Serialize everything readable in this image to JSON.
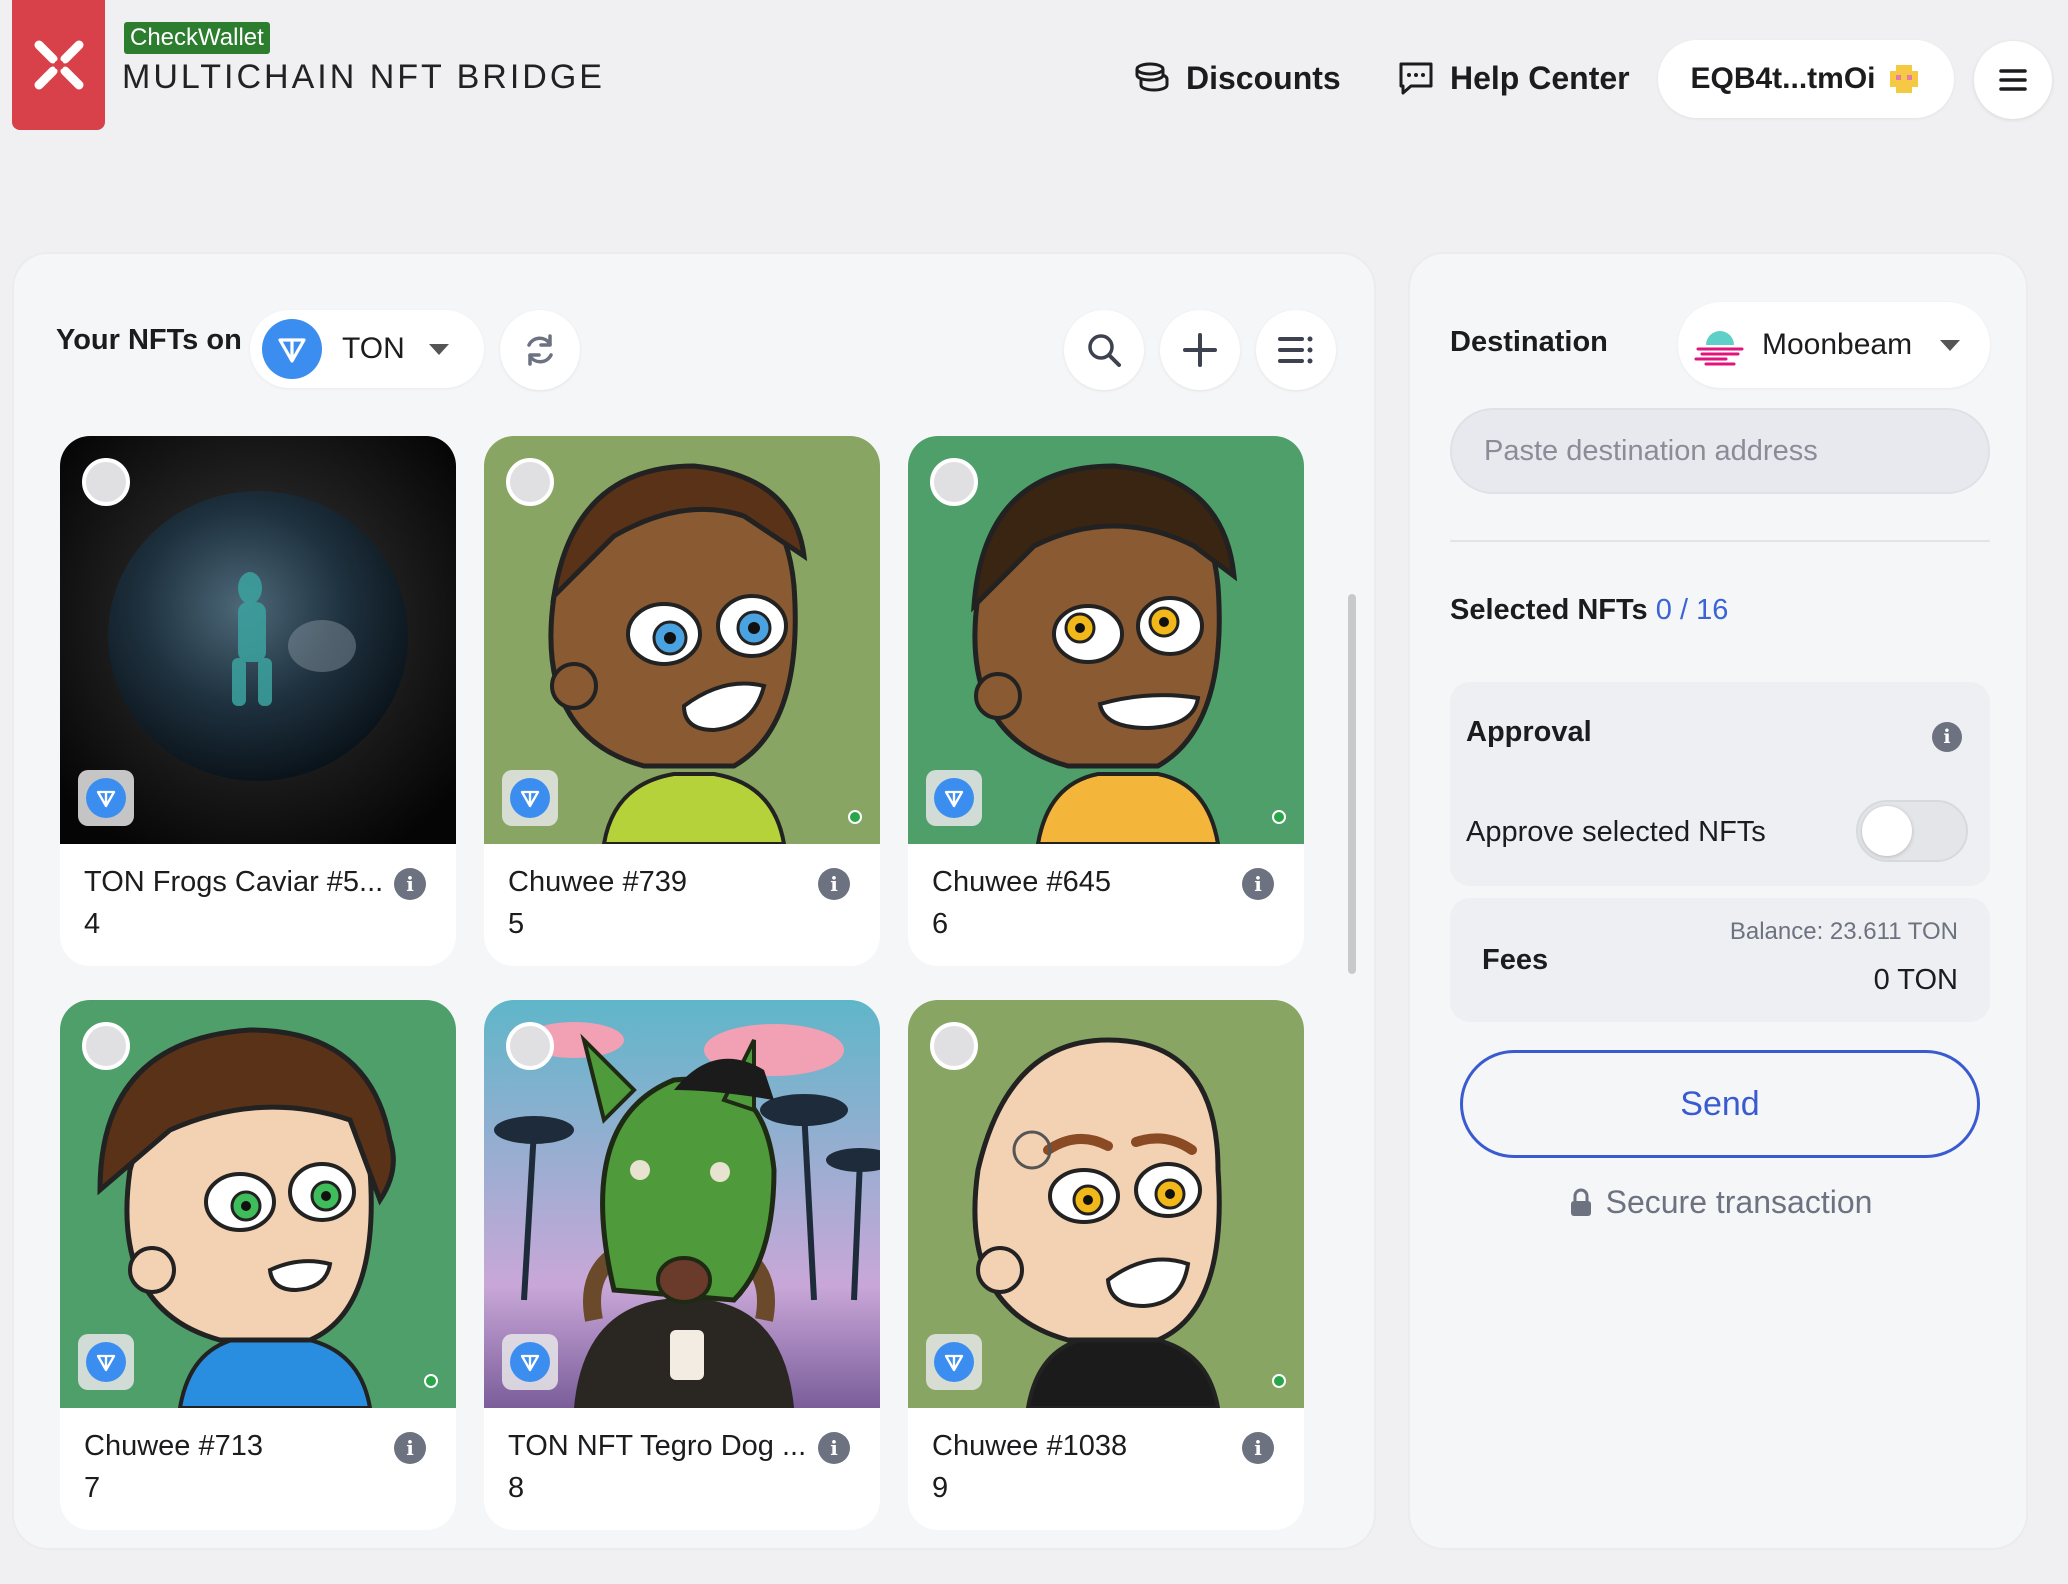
{
  "header": {
    "badge": "CheckWallet",
    "title": "MULTICHAIN NFT BRIDGE",
    "discounts": "Discounts",
    "help_center": "Help Center",
    "wallet_address": "EQB4t...tmOi",
    "logo_icon": "xp-network-logo-icon",
    "menu_icon": "hamburger-menu-icon"
  },
  "nfts_panel": {
    "label": "Your NFTs on",
    "chain": "TON",
    "icons": [
      "refresh-icon",
      "search-icon",
      "plus-icon",
      "list-filter-icon"
    ],
    "items": [
      {
        "name": "TON Frogs Caviar #5...",
        "id": "4"
      },
      {
        "name": "Chuwee #739",
        "id": "5"
      },
      {
        "name": "Chuwee #645",
        "id": "6"
      },
      {
        "name": "Chuwee #713",
        "id": "7"
      },
      {
        "name": "TON NFT Tegro Dog ...",
        "id": "8"
      },
      {
        "name": "Chuwee #1038",
        "id": "9"
      }
    ]
  },
  "destination_panel": {
    "label": "Destination",
    "chain": "Moonbeam",
    "address_placeholder": "Paste destination address",
    "selected_label": "Selected NFTs",
    "selected_count": "0 / 16",
    "approval_title": "Approval",
    "approve_text": "Approve selected NFTs",
    "approve_enabled": false,
    "fees_label": "Fees",
    "balance": "Balance: 23.611 TON",
    "fee_value": "0 TON",
    "send_label": "Send",
    "secure_label": "Secure transaction"
  },
  "colors": {
    "brand_red": "#d8404a",
    "badge_green": "#2d7d2f",
    "ton_blue": "#3b8ef0",
    "accent_blue": "#3a5bd0"
  }
}
